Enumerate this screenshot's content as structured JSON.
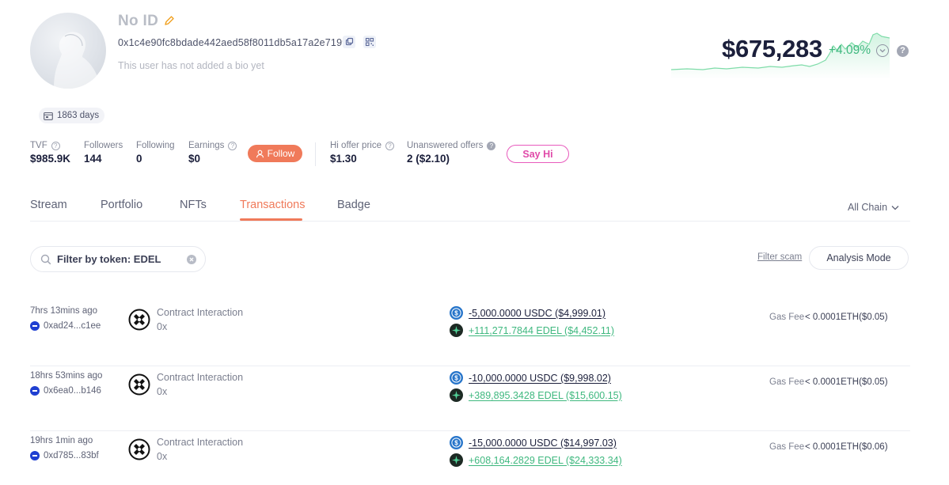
{
  "profile": {
    "name": "No ID",
    "address": "0x1c4e90fc8bdade442aed58f8011db5a17a2e7199",
    "bio": "This user has not added a bio yet",
    "days_badge": "1863 days"
  },
  "networth": {
    "value": "$675,283",
    "change": "+4.09%",
    "change_color": "#3fb87f"
  },
  "stats": {
    "tvf": {
      "label": "TVF",
      "value": "$985.9K"
    },
    "followers": {
      "label": "Followers",
      "value": "144"
    },
    "following": {
      "label": "Following",
      "value": "0"
    },
    "earnings": {
      "label": "Earnings",
      "value": "$0"
    },
    "follow_button": "Follow",
    "hi_offer": {
      "label": "Hi offer price",
      "value": "$1.30"
    },
    "unanswered": {
      "label": "Unanswered offers",
      "value": "2 ($2.10)"
    },
    "say_hi_button": "Say Hi"
  },
  "tabs": [
    "Stream",
    "Portfolio",
    "NFTs",
    "Transactions",
    "Badge"
  ],
  "active_tab": "Transactions",
  "chain_filter": "All Chain",
  "filter": {
    "search_value": "Filter by token: EDEL",
    "filter_scam": "Filter scam",
    "analysis_mode": "Analysis Mode"
  },
  "accent_color": "#f07a5a",
  "transactions": [
    {
      "time": "7hrs 13mins ago",
      "chain_addr": "0xad24...c1ee",
      "type": "Contract Interaction",
      "to": "0x",
      "out": "-5,000.0000 USDC ($4,999.01)",
      "in": "+111,271.7844 EDEL ($4,452.11)",
      "gas_label": "Gas Fee",
      "gas_value": "< 0.0001ETH($0.05)"
    },
    {
      "time": "18hrs 53mins ago",
      "chain_addr": "0x6ea0...b146",
      "type": "Contract Interaction",
      "to": "0x",
      "out": "-10,000.0000 USDC ($9,998.02)",
      "in": "+389,895.3428 EDEL ($15,600.15)",
      "gas_label": "Gas Fee",
      "gas_value": "< 0.0001ETH($0.05)"
    },
    {
      "time": "19hrs 1min ago",
      "chain_addr": "0xd785...83bf",
      "type": "Contract Interaction",
      "to": "0x",
      "out": "-15,000.0000 USDC ($14,997.03)",
      "in": "+608,164.2829 EDEL ($24,333.34)",
      "gas_label": "Gas Fee",
      "gas_value": "< 0.0001ETH($0.06)"
    }
  ]
}
